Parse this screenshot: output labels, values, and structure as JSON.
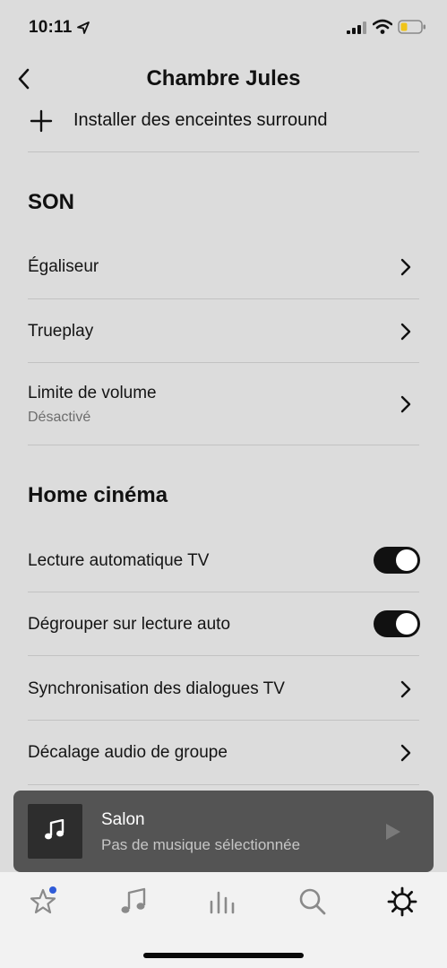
{
  "status_bar": {
    "time": "10:11"
  },
  "header": {
    "title": "Chambre Jules"
  },
  "surround": {
    "label": "Installer des enceintes surround"
  },
  "son": {
    "title": "SON",
    "items": [
      {
        "label": "Égaliseur"
      },
      {
        "label": "Trueplay"
      },
      {
        "label": "Limite de volume",
        "sub": "Désactivé"
      }
    ]
  },
  "home_cinema": {
    "title": "Home cinéma",
    "toggles": [
      {
        "label": "Lecture automatique TV",
        "on": true
      },
      {
        "label": "Dégrouper sur lecture auto",
        "on": true
      }
    ],
    "items": [
      {
        "label": "Synchronisation des dialogues TV"
      },
      {
        "label": "Décalage audio de groupe"
      }
    ]
  },
  "player": {
    "room": "Salon",
    "status": "Pas de musique sélectionnée"
  },
  "nav": {
    "items": [
      {
        "icon": "star-icon",
        "has_dot": true,
        "dot_color": "#2f5bd8"
      },
      {
        "icon": "music-note-icon"
      },
      {
        "icon": "rooms-icon"
      },
      {
        "icon": "search-icon"
      },
      {
        "icon": "gear-icon",
        "active": true
      }
    ]
  },
  "colors": {
    "background": "#dcdcdc",
    "player_bg": "#545454",
    "toggle_on": "#111111",
    "nav_bg": "#f2f2f2"
  }
}
